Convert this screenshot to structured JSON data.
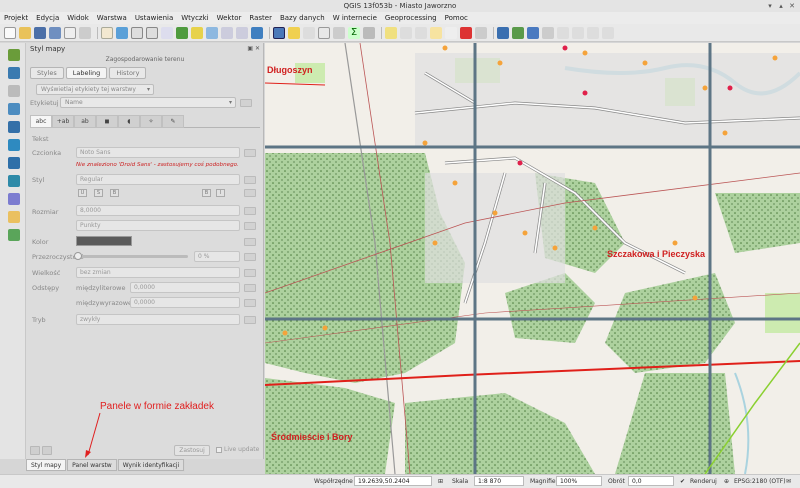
{
  "window": {
    "title": "QGIS 13f053b - Miasto Jaworzno"
  },
  "menu": [
    "Projekt",
    "Edycja",
    "Widok",
    "Warstwa",
    "Ustawienia",
    "Wtyczki",
    "Wektor",
    "Raster",
    "Bazy danych",
    "W internecie",
    "Geoprocessing",
    "Pomoc"
  ],
  "panel": {
    "title": "Styl mapy",
    "subtitle": "Zagospodarowanie terenu",
    "tabs": [
      "Styles",
      "Labeling",
      "History"
    ],
    "labeling_mode": "Wyświetlaj etykiety tej warstwy",
    "label_with_label": "Etykietuj z",
    "label_with_value": "Name",
    "section": "Tekst",
    "font_label": "Czcionka",
    "font_value": "Noto Sans",
    "font_warning": "Nie znaleziono 'Droid Sans' - zastosujemy coś podobnego.",
    "style_label": "Styl",
    "style_value": "Regular",
    "size_label": "Rozmiar",
    "size_value": "8,0000",
    "unit_value": "Punkty",
    "color_label": "Kolor",
    "transparency_label": "Przezroczystość",
    "transparency_value": "0 %",
    "case_label": "Wielkość",
    "case_value": "bez zmian",
    "spacing_label": "Odstępy",
    "letter_spacing_label": "międzyliterowe",
    "letter_spacing_value": "0,0000",
    "word_spacing_label": "międzywyrazowe",
    "word_spacing_value": "0,0000",
    "blend_label": "Tryb",
    "blend_value": "zwykły",
    "apply": "Zastosuj",
    "live_update": "Live update"
  },
  "bottom_tabs": [
    "Styl mapy",
    "Panel warstw",
    "Wynik identyfikacji"
  ],
  "annotation": "Panele w formie zakładek",
  "map_labels": {
    "north_west": "Długoszyn",
    "east": "Szczakowa i Pieczyska",
    "south_west": "Śródmieście i Bory"
  },
  "status": {
    "coord_label": "Współrzędne",
    "coord_value": "19.2639,50.2404",
    "scale_label": "Skala",
    "scale_value": "1:8 870",
    "magnifier_label": "Magnifier",
    "magnifier_value": "100%",
    "rotation_label": "Obrót",
    "rotation_value": "0,0",
    "render_label": "Renderuj",
    "crs": "EPSG:2180 (OTF)"
  }
}
